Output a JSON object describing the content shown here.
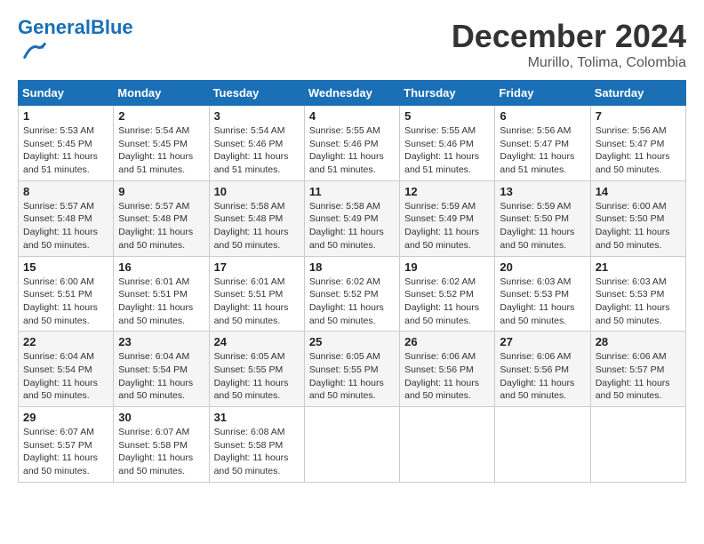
{
  "header": {
    "logo_general": "General",
    "logo_blue": "Blue",
    "month_title": "December 2024",
    "location": "Murillo, Tolima, Colombia"
  },
  "days_of_week": [
    "Sunday",
    "Monday",
    "Tuesday",
    "Wednesday",
    "Thursday",
    "Friday",
    "Saturday"
  ],
  "weeks": [
    [
      {
        "num": "1",
        "info": "Sunrise: 5:53 AM\nSunset: 5:45 PM\nDaylight: 11 hours\nand 51 minutes."
      },
      {
        "num": "2",
        "info": "Sunrise: 5:54 AM\nSunset: 5:45 PM\nDaylight: 11 hours\nand 51 minutes."
      },
      {
        "num": "3",
        "info": "Sunrise: 5:54 AM\nSunset: 5:46 PM\nDaylight: 11 hours\nand 51 minutes."
      },
      {
        "num": "4",
        "info": "Sunrise: 5:55 AM\nSunset: 5:46 PM\nDaylight: 11 hours\nand 51 minutes."
      },
      {
        "num": "5",
        "info": "Sunrise: 5:55 AM\nSunset: 5:46 PM\nDaylight: 11 hours\nand 51 minutes."
      },
      {
        "num": "6",
        "info": "Sunrise: 5:56 AM\nSunset: 5:47 PM\nDaylight: 11 hours\nand 51 minutes."
      },
      {
        "num": "7",
        "info": "Sunrise: 5:56 AM\nSunset: 5:47 PM\nDaylight: 11 hours\nand 50 minutes."
      }
    ],
    [
      {
        "num": "8",
        "info": "Sunrise: 5:57 AM\nSunset: 5:48 PM\nDaylight: 11 hours\nand 50 minutes."
      },
      {
        "num": "9",
        "info": "Sunrise: 5:57 AM\nSunset: 5:48 PM\nDaylight: 11 hours\nand 50 minutes."
      },
      {
        "num": "10",
        "info": "Sunrise: 5:58 AM\nSunset: 5:48 PM\nDaylight: 11 hours\nand 50 minutes."
      },
      {
        "num": "11",
        "info": "Sunrise: 5:58 AM\nSunset: 5:49 PM\nDaylight: 11 hours\nand 50 minutes."
      },
      {
        "num": "12",
        "info": "Sunrise: 5:59 AM\nSunset: 5:49 PM\nDaylight: 11 hours\nand 50 minutes."
      },
      {
        "num": "13",
        "info": "Sunrise: 5:59 AM\nSunset: 5:50 PM\nDaylight: 11 hours\nand 50 minutes."
      },
      {
        "num": "14",
        "info": "Sunrise: 6:00 AM\nSunset: 5:50 PM\nDaylight: 11 hours\nand 50 minutes."
      }
    ],
    [
      {
        "num": "15",
        "info": "Sunrise: 6:00 AM\nSunset: 5:51 PM\nDaylight: 11 hours\nand 50 minutes."
      },
      {
        "num": "16",
        "info": "Sunrise: 6:01 AM\nSunset: 5:51 PM\nDaylight: 11 hours\nand 50 minutes."
      },
      {
        "num": "17",
        "info": "Sunrise: 6:01 AM\nSunset: 5:51 PM\nDaylight: 11 hours\nand 50 minutes."
      },
      {
        "num": "18",
        "info": "Sunrise: 6:02 AM\nSunset: 5:52 PM\nDaylight: 11 hours\nand 50 minutes."
      },
      {
        "num": "19",
        "info": "Sunrise: 6:02 AM\nSunset: 5:52 PM\nDaylight: 11 hours\nand 50 minutes."
      },
      {
        "num": "20",
        "info": "Sunrise: 6:03 AM\nSunset: 5:53 PM\nDaylight: 11 hours\nand 50 minutes."
      },
      {
        "num": "21",
        "info": "Sunrise: 6:03 AM\nSunset: 5:53 PM\nDaylight: 11 hours\nand 50 minutes."
      }
    ],
    [
      {
        "num": "22",
        "info": "Sunrise: 6:04 AM\nSunset: 5:54 PM\nDaylight: 11 hours\nand 50 minutes."
      },
      {
        "num": "23",
        "info": "Sunrise: 6:04 AM\nSunset: 5:54 PM\nDaylight: 11 hours\nand 50 minutes."
      },
      {
        "num": "24",
        "info": "Sunrise: 6:05 AM\nSunset: 5:55 PM\nDaylight: 11 hours\nand 50 minutes."
      },
      {
        "num": "25",
        "info": "Sunrise: 6:05 AM\nSunset: 5:55 PM\nDaylight: 11 hours\nand 50 minutes."
      },
      {
        "num": "26",
        "info": "Sunrise: 6:06 AM\nSunset: 5:56 PM\nDaylight: 11 hours\nand 50 minutes."
      },
      {
        "num": "27",
        "info": "Sunrise: 6:06 AM\nSunset: 5:56 PM\nDaylight: 11 hours\nand 50 minutes."
      },
      {
        "num": "28",
        "info": "Sunrise: 6:06 AM\nSunset: 5:57 PM\nDaylight: 11 hours\nand 50 minutes."
      }
    ],
    [
      {
        "num": "29",
        "info": "Sunrise: 6:07 AM\nSunset: 5:57 PM\nDaylight: 11 hours\nand 50 minutes."
      },
      {
        "num": "30",
        "info": "Sunrise: 6:07 AM\nSunset: 5:58 PM\nDaylight: 11 hours\nand 50 minutes."
      },
      {
        "num": "31",
        "info": "Sunrise: 6:08 AM\nSunset: 5:58 PM\nDaylight: 11 hours\nand 50 minutes."
      },
      null,
      null,
      null,
      null
    ]
  ]
}
